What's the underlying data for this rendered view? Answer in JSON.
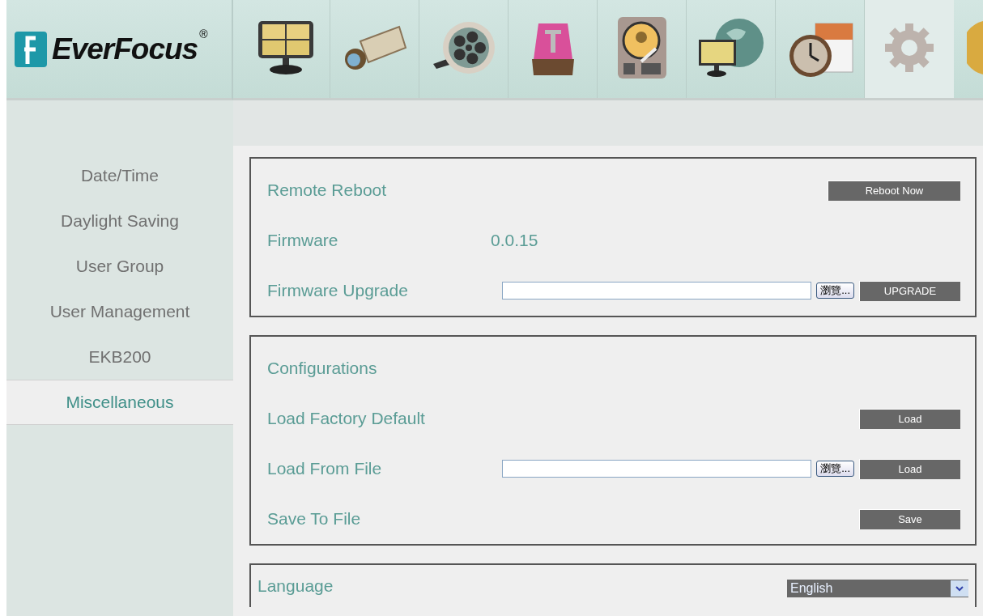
{
  "logo": {
    "text": "EverFocus",
    "mark": "®"
  },
  "toolbar": [
    {
      "kind": "monitor",
      "selected": false
    },
    {
      "kind": "camera",
      "selected": false
    },
    {
      "kind": "reel",
      "selected": false
    },
    {
      "kind": "alarm",
      "selected": false
    },
    {
      "kind": "disk",
      "selected": false
    },
    {
      "kind": "globe",
      "selected": false
    },
    {
      "kind": "clock",
      "selected": false
    },
    {
      "kind": "gear",
      "selected": true
    },
    {
      "kind": "partial",
      "selected": false
    }
  ],
  "sidebar": {
    "items": [
      {
        "label": "Date/Time",
        "selected": false
      },
      {
        "label": "Daylight Saving",
        "selected": false
      },
      {
        "label": "User Group",
        "selected": false
      },
      {
        "label": "User Management",
        "selected": false
      },
      {
        "label": "EKB200",
        "selected": false
      },
      {
        "label": "Miscellaneous",
        "selected": true
      }
    ]
  },
  "sections": [
    {
      "rows": [
        {
          "kind": "button",
          "label": "Remote Reboot",
          "button": "Reboot Now"
        },
        {
          "kind": "text",
          "label": "Firmware",
          "value": "0.0.15"
        },
        {
          "kind": "file",
          "label": "Firmware Upgrade",
          "browse": "瀏覽...",
          "button": "UPGRADE"
        }
      ]
    },
    {
      "rows": [
        {
          "kind": "heading",
          "label": "Configurations"
        },
        {
          "kind": "button",
          "label": "Load Factory Default",
          "button": "Load"
        },
        {
          "kind": "file",
          "label": "Load From File",
          "browse": "瀏覽...",
          "button": "Load"
        },
        {
          "kind": "button",
          "label": "Save To File",
          "button": "Save"
        }
      ]
    }
  ],
  "language": {
    "label": "Language",
    "value": "English"
  }
}
